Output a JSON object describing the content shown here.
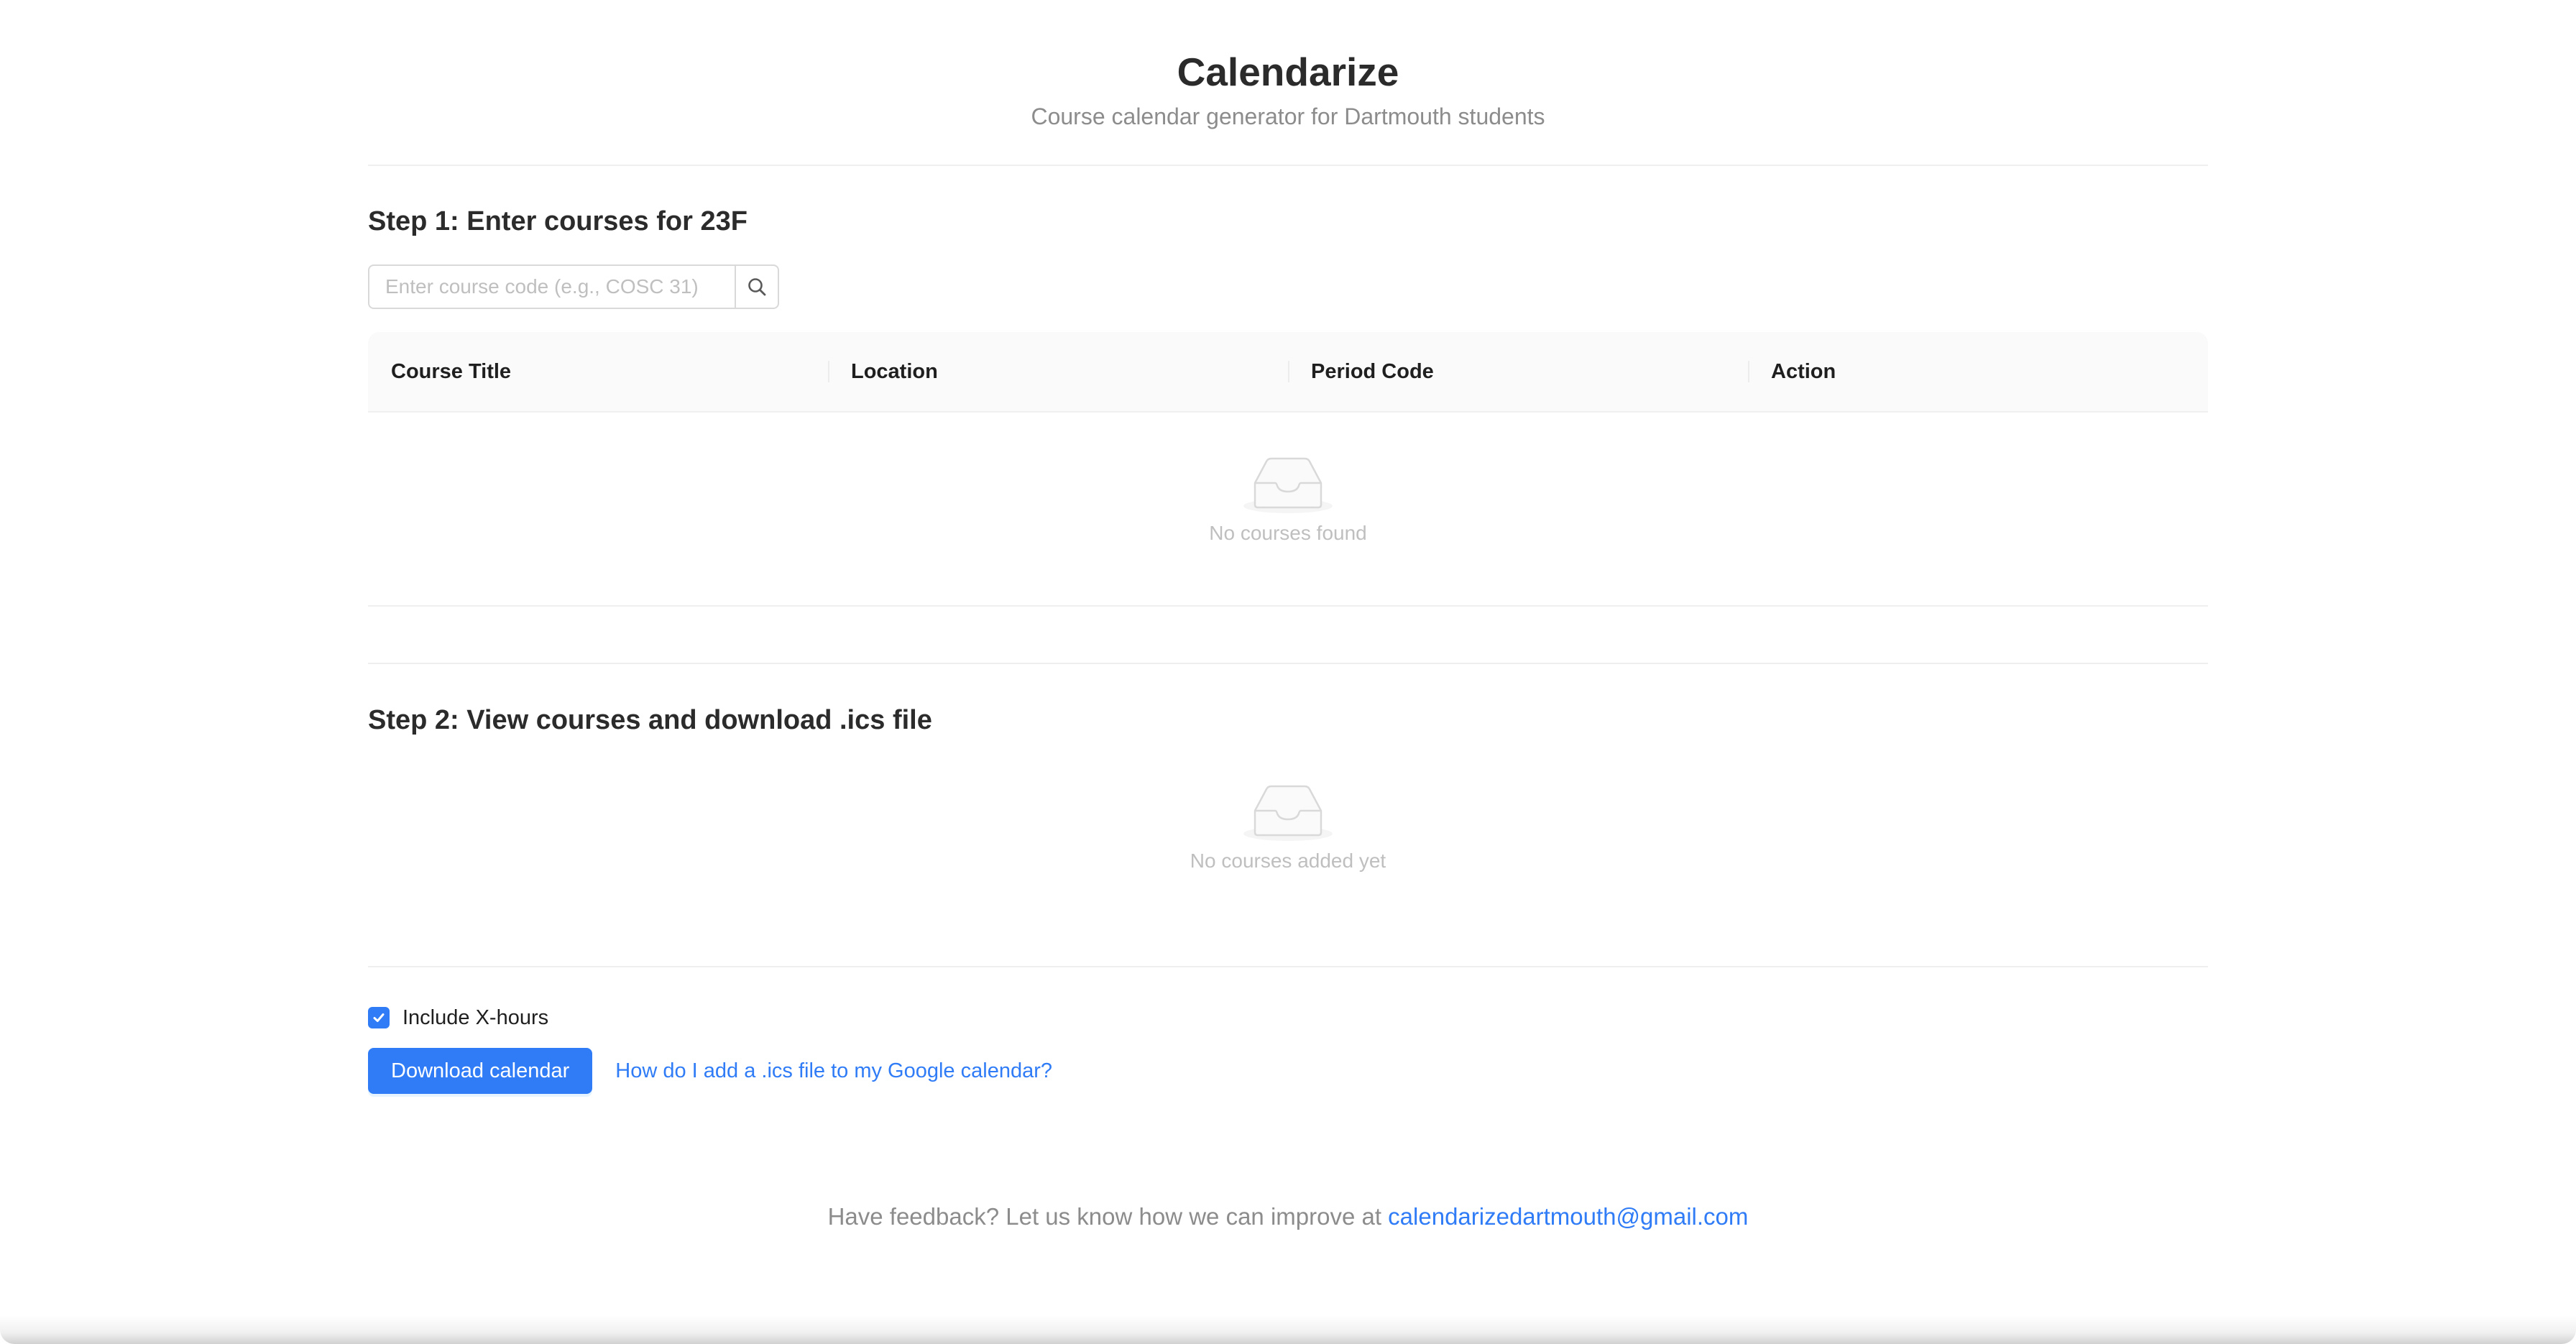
{
  "header": {
    "title": "Calendarize",
    "subtitle": "Course calendar generator for Dartmouth students"
  },
  "step1": {
    "title": "Step 1: Enter courses for 23F",
    "search": {
      "placeholder": "Enter course code (e.g., COSC 31)",
      "value": "",
      "button_icon": "search-icon"
    },
    "table": {
      "columns": [
        "Course Title",
        "Location",
        "Period Code",
        "Action"
      ],
      "rows": [],
      "empty_icon": "inbox-icon",
      "empty_text": "No courses found"
    }
  },
  "step2": {
    "title": "Step 2: View courses and download .ics file",
    "empty_icon": "inbox-icon",
    "empty_text": "No courses added yet"
  },
  "options": {
    "xhours_label": "Include X-hours",
    "xhours_checked": true
  },
  "actions": {
    "download_label": "Download calendar",
    "help_link": "How do I add a .ics file to my Google calendar?"
  },
  "footer": {
    "text": "Have feedback? Let us know how we can improve at ",
    "email": "calendarizedartmouth@gmail.com"
  },
  "colors": {
    "primary": "#2f7cf6",
    "muted_text": "#8c8c8c",
    "placeholder": "#bfbfbf",
    "border": "#d9d9d9",
    "table_header_bg": "#fafafa"
  }
}
